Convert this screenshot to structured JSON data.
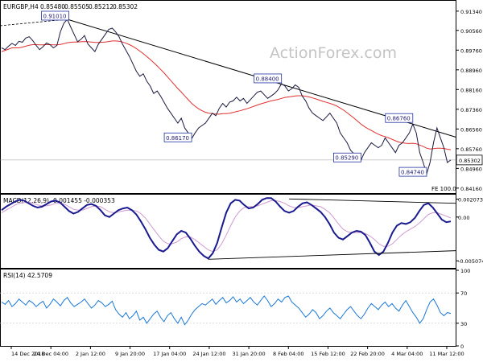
{
  "chart_data": {
    "type": "line",
    "symbol": "EURGBP,H4",
    "ohlc_header": {
      "open": "0.85480",
      "high": "0.85505",
      "low": "0.85212",
      "close": "0.85302"
    },
    "watermark": "ActionForex.com",
    "x_tick_labels": [
      "14 Dec 2018",
      "24 Dec 04:00",
      "2 Jan 12:00",
      "9 Jan 20:00",
      "17 Jan 04:00",
      "24 Jan 12:00",
      "31 Jan 20:00",
      "8 Feb 04:00",
      "15 Feb 12:00",
      "22 Feb 20:00",
      "4 Mar 04:00",
      "11 Mar 12:00"
    ],
    "price_panel": {
      "ylim": [
        0.8396,
        0.9176
      ],
      "y_ticks": [
        "0.91340",
        "0.90560",
        "0.89760",
        "0.88960",
        "0.88160",
        "0.87360",
        "0.86560",
        "0.85760",
        "0.84960",
        "0.84160"
      ],
      "last_price_label": "0.85302",
      "last_price": 0.85302,
      "series": [
        {
          "name": "price",
          "color": "#1a1a40",
          "values": [
            0.8985,
            0.8978,
            0.8992,
            0.9003,
            0.8995,
            0.9012,
            0.9008,
            0.9025,
            0.903,
            0.9015,
            0.8995,
            0.8978,
            0.899,
            0.9005,
            0.8998,
            0.8985,
            0.8995,
            0.905,
            0.9085,
            0.9101,
            0.907,
            0.904,
            0.901,
            0.902,
            0.9035,
            0.9,
            0.8985,
            0.897,
            0.9,
            0.902,
            0.904,
            0.906,
            0.9065,
            0.905,
            0.903,
            0.9,
            0.8975,
            0.895,
            0.892,
            0.889,
            0.887,
            0.888,
            0.885,
            0.883,
            0.88,
            0.881,
            0.879,
            0.8765,
            0.874,
            0.872,
            0.87,
            0.868,
            0.87,
            0.866,
            0.864,
            0.8617,
            0.864,
            0.866,
            0.867,
            0.868,
            0.87,
            0.872,
            0.871,
            0.874,
            0.876,
            0.8745,
            0.8765,
            0.877,
            0.8785,
            0.877,
            0.878,
            0.876,
            0.8775,
            0.879,
            0.8805,
            0.881,
            0.8795,
            0.878,
            0.879,
            0.88,
            0.8815,
            0.884,
            0.883,
            0.881,
            0.882,
            0.8835,
            0.8825,
            0.879,
            0.877,
            0.874,
            0.872,
            0.871,
            0.87,
            0.869,
            0.8705,
            0.872,
            0.87,
            0.868,
            0.864,
            0.862,
            0.86,
            0.857,
            0.8555,
            0.854,
            0.8529,
            0.856,
            0.858,
            0.86,
            0.859,
            0.858,
            0.859,
            0.862,
            0.86,
            0.858,
            0.856,
            0.859,
            0.86,
            0.862,
            0.864,
            0.8676,
            0.864,
            0.856,
            0.852,
            0.8474,
            0.852,
            0.86,
            0.866,
            0.862,
            0.858,
            0.852,
            0.853
          ]
        },
        {
          "name": "SMA",
          "color": "#e03030",
          "values": [
            0.897,
            0.8975,
            0.898,
            0.8985,
            0.8985,
            0.8985,
            0.8988,
            0.8992,
            0.8996,
            0.8998,
            0.8998,
            0.8997,
            0.8997,
            0.8998,
            0.8998,
            0.8997,
            0.8997,
            0.8999,
            0.9002,
            0.9006,
            0.9008,
            0.9009,
            0.9009,
            0.901,
            0.9011,
            0.901,
            0.9009,
            0.9007,
            0.9007,
            0.9008,
            0.9009,
            0.9011,
            0.9013,
            0.9013,
            0.9012,
            0.9009,
            0.9004,
            0.8998,
            0.8991,
            0.8982,
            0.8972,
            0.8962,
            0.895,
            0.8938,
            0.8925,
            0.8912,
            0.8898,
            0.8884,
            0.8868,
            0.8852,
            0.8836,
            0.882,
            0.8806,
            0.879,
            0.8775,
            0.876,
            0.8748,
            0.8738,
            0.873,
            0.8724,
            0.872,
            0.8718,
            0.8716,
            0.8716,
            0.8718,
            0.8718,
            0.872,
            0.8723,
            0.8727,
            0.873,
            0.8734,
            0.8738,
            0.8743,
            0.8748,
            0.8753,
            0.8758,
            0.8762,
            0.8766,
            0.877,
            0.8773,
            0.8776,
            0.878,
            0.8784,
            0.8786,
            0.8788,
            0.879,
            0.8791,
            0.8791,
            0.8789,
            0.8786,
            0.8782,
            0.8778,
            0.8773,
            0.8768,
            0.8764,
            0.876,
            0.8755,
            0.8749,
            0.8741,
            0.8732,
            0.8722,
            0.8711,
            0.87,
            0.8688,
            0.8676,
            0.8666,
            0.8657,
            0.865,
            0.8642,
            0.8635,
            0.8629,
            0.8625,
            0.862,
            0.8614,
            0.8608,
            0.8603,
            0.86,
            0.8598,
            0.8597,
            0.8598,
            0.8596,
            0.8591,
            0.8585,
            0.8578,
            0.8575,
            0.8576,
            0.8578,
            0.8578,
            0.8577,
            0.8574,
            0.8572
          ]
        }
      ],
      "annotations": [
        {
          "label": "0.91010",
          "value": 0.9101
        },
        {
          "label": "0.88400",
          "value": 0.884
        },
        {
          "label": "0.86170",
          "value": 0.8617
        },
        {
          "label": "0.86760",
          "value": 0.8676
        },
        {
          "label": "0.85290",
          "value": 0.8529
        },
        {
          "label": "0.84740",
          "value": 0.8474
        }
      ],
      "corner_label": "FE 100.0",
      "trendline": {
        "from": [
          0.9101,
          "24 Dec"
        ],
        "to": [
          0.8676,
          "11 Mar"
        ]
      }
    },
    "macd_panel": {
      "title": "MACD(12,26,9) -0.001455 -0.000353",
      "ylim": [
        -0.0058,
        0.0025
      ],
      "y_ticks": [
        "0.002073",
        "0.00",
        "-0.005074"
      ],
      "series": [
        {
          "name": "MACD",
          "color": "#1a1a90",
          "values": [
            0.0008,
            0.0012,
            0.0015,
            0.0018,
            0.002,
            0.0019,
            0.0016,
            0.0013,
            0.0011,
            0.0012,
            0.0015,
            0.0018,
            0.0019,
            0.0017,
            0.0012,
            0.0007,
            0.0004,
            0.0006,
            0.001,
            0.0014,
            0.0015,
            0.0013,
            0.0008,
            0.0002,
            0.0,
            0.0004,
            0.0008,
            0.001,
            0.0011,
            0.0008,
            0.0003,
            -0.0005,
            -0.0014,
            -0.0024,
            -0.0032,
            -0.0038,
            -0.004,
            -0.0036,
            -0.0028,
            -0.002,
            -0.0016,
            -0.0018,
            -0.0025,
            -0.0033,
            -0.004,
            -0.0045,
            -0.0048,
            -0.0042,
            -0.003,
            -0.0012,
            0.0005,
            0.0016,
            0.002,
            0.0019,
            0.0014,
            0.001,
            0.0011,
            0.0015,
            0.002,
            0.0022,
            0.0022,
            0.0018,
            0.0012,
            0.0007,
            0.0005,
            0.0007,
            0.0012,
            0.0016,
            0.0017,
            0.0014,
            0.001,
            0.0006,
            0.0,
            -0.0008,
            -0.0018,
            -0.0024,
            -0.0026,
            -0.0022,
            -0.0018,
            -0.0016,
            -0.0017,
            -0.0021,
            -0.003,
            -0.004,
            -0.0044,
            -0.004,
            -0.003,
            -0.0018,
            -0.001,
            -0.0007,
            -0.0008,
            -0.0006,
            -0.0001,
            0.0007,
            0.0014,
            0.0016,
            0.0011,
            0.0004,
            -0.0003,
            -0.0006,
            -0.0005
          ]
        },
        {
          "name": "Signal",
          "color": "#d09ad0",
          "values": [
            0.0005,
            0.0008,
            0.0011,
            0.0014,
            0.0016,
            0.0017,
            0.0017,
            0.0016,
            0.0014,
            0.0013,
            0.0013,
            0.0014,
            0.0016,
            0.0016,
            0.0015,
            0.0012,
            0.0009,
            0.0008,
            0.0008,
            0.001,
            0.0012,
            0.0013,
            0.0012,
            0.0009,
            0.0006,
            0.0005,
            0.0006,
            0.0007,
            0.0008,
            0.0008,
            0.0007,
            0.0004,
            -0.0001,
            -0.0008,
            -0.0015,
            -0.0022,
            -0.0028,
            -0.0031,
            -0.0031,
            -0.0029,
            -0.0025,
            -0.0023,
            -0.0023,
            -0.0026,
            -0.003,
            -0.0034,
            -0.0038,
            -0.004,
            -0.0038,
            -0.0031,
            -0.0021,
            -0.001,
            0.0,
            0.0007,
            0.0011,
            0.0012,
            0.0012,
            0.0013,
            0.0015,
            0.0017,
            0.0019,
            0.0019,
            0.0018,
            0.0016,
            0.0013,
            0.0011,
            0.0011,
            0.0012,
            0.0013,
            0.0014,
            0.0013,
            0.0012,
            0.0009,
            0.0005,
            -0.0001,
            -0.0008,
            -0.0014,
            -0.0017,
            -0.0018,
            -0.0018,
            -0.0018,
            -0.0019,
            -0.0022,
            -0.0026,
            -0.0031,
            -0.0034,
            -0.0034,
            -0.0031,
            -0.0026,
            -0.0021,
            -0.0017,
            -0.0014,
            -0.0011,
            -0.0007,
            -0.0002,
            0.0003,
            0.0005,
            0.0005,
            0.0003,
            0.0001,
            -0.0001
          ]
        }
      ],
      "trendlines": [
        {
          "from": [
            0.0019,
            "31 Jan"
          ],
          "to": [
            0.0016,
            "11 Mar"
          ]
        },
        {
          "from": [
            -0.0048,
            "24 Jan"
          ],
          "to": [
            -0.0039,
            "14 Mar"
          ]
        }
      ]
    },
    "rsi_panel": {
      "title": "RSI(14) 42.5709",
      "ylim": [
        0,
        100
      ],
      "y_ticks": [
        "100",
        "70",
        "30",
        "0"
      ],
      "series": [
        {
          "name": "RSI",
          "color": "#1a78d8",
          "values": [
            58,
            55,
            60,
            52,
            56,
            62,
            58,
            54,
            60,
            57,
            52,
            56,
            59,
            50,
            55,
            62,
            58,
            53,
            60,
            64,
            57,
            52,
            55,
            58,
            62,
            56,
            50,
            54,
            60,
            57,
            52,
            55,
            59,
            48,
            42,
            38,
            44,
            36,
            40,
            46,
            34,
            38,
            30,
            36,
            42,
            46,
            38,
            32,
            40,
            44,
            36,
            30,
            38,
            28,
            34,
            42,
            48,
            52,
            56,
            54,
            58,
            62,
            55,
            60,
            64,
            57,
            60,
            65,
            58,
            62,
            56,
            60,
            64,
            58,
            54,
            60,
            66,
            60,
            52,
            56,
            62,
            58,
            64,
            66,
            58,
            54,
            50,
            44,
            38,
            42,
            48,
            44,
            36,
            40,
            46,
            50,
            44,
            40,
            36,
            42,
            48,
            52,
            46,
            40,
            36,
            42,
            50,
            56,
            52,
            48,
            54,
            58,
            52,
            56,
            50,
            46,
            54,
            60,
            52,
            44,
            38,
            30,
            36,
            48,
            58,
            62,
            54,
            44,
            40,
            44,
            43
          ]
        }
      ]
    }
  }
}
